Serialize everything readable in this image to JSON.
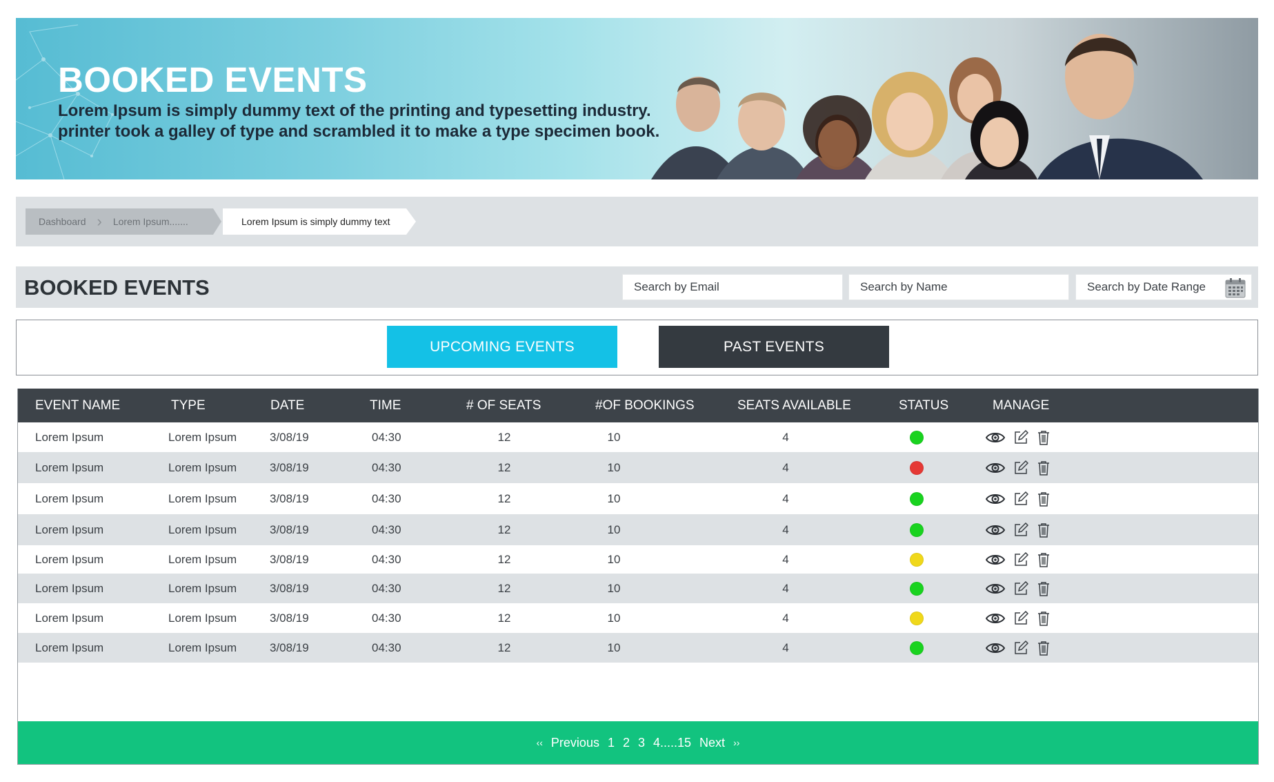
{
  "banner": {
    "title": "BOOKED EVENTS",
    "subtitle_line1": "Lorem Ipsum is simply dummy text of the printing and typesetting industry.",
    "subtitle_line2": "printer took a galley of type and scrambled it to make a type specimen book."
  },
  "breadcrumb": {
    "items": [
      "Dashboard",
      "Lorem Ipsum.......",
      "Lorem Ipsum is simply dummy text"
    ]
  },
  "section": {
    "title": "BOOKED EVENTS",
    "search_email": "Search by Email",
    "search_name": "Search by Name",
    "search_date": "Search by Date Range"
  },
  "tabs": {
    "upcoming": "UPCOMING EVENTS",
    "past": "PAST EVENTS",
    "active": "upcoming"
  },
  "colors": {
    "accent": "#14c1e6",
    "header_dark": "#3d4349",
    "pager_green": "#12c37f",
    "status_green": "#19d31f",
    "status_red": "#e53935",
    "status_yellow": "#f0d81a"
  },
  "table": {
    "columns": [
      "EVENT NAME",
      "TYPE",
      "DATE",
      "TIME",
      "# OF SEATS",
      "#OF BOOKINGS",
      "SEATS AVAILABLE",
      "STATUS",
      "MANAGE"
    ],
    "rows": [
      {
        "name": "Lorem Ipsum",
        "type": "Lorem Ipsum",
        "date": "3/08/19",
        "time": "04:30",
        "seats": "12",
        "bookings": "10",
        "available": "4",
        "status": "green"
      },
      {
        "name": "Lorem Ipsum",
        "type": "Lorem Ipsum",
        "date": "3/08/19",
        "time": "04:30",
        "seats": "12",
        "bookings": "10",
        "available": "4",
        "status": "red"
      },
      {
        "name": "Lorem Ipsum",
        "type": "Lorem Ipsum",
        "date": "3/08/19",
        "time": "04:30",
        "seats": "12",
        "bookings": "10",
        "available": "4",
        "status": "green"
      },
      {
        "name": "Lorem Ipsum",
        "type": "Lorem Ipsum",
        "date": "3/08/19",
        "time": "04:30",
        "seats": "12",
        "bookings": "10",
        "available": "4",
        "status": "green"
      },
      {
        "name": "Lorem Ipsum",
        "type": "Lorem Ipsum",
        "date": "3/08/19",
        "time": "04:30",
        "seats": "12",
        "bookings": "10",
        "available": "4",
        "status": "yellow"
      },
      {
        "name": "Lorem Ipsum",
        "type": "Lorem Ipsum",
        "date": "3/08/19",
        "time": "04:30",
        "seats": "12",
        "bookings": "10",
        "available": "4",
        "status": "green"
      },
      {
        "name": "Lorem Ipsum",
        "type": "Lorem Ipsum",
        "date": "3/08/19",
        "time": "04:30",
        "seats": "12",
        "bookings": "10",
        "available": "4",
        "status": "yellow"
      },
      {
        "name": "Lorem Ipsum",
        "type": "Lorem Ipsum",
        "date": "3/08/19",
        "time": "04:30",
        "seats": "12",
        "bookings": "10",
        "available": "4",
        "status": "green"
      }
    ],
    "manage_icons": [
      "eye-icon",
      "edit-icon",
      "trash-icon"
    ]
  },
  "pagination": {
    "prev_glyph": "‹‹",
    "previous": "Previous",
    "pages": [
      "1",
      "2",
      "3",
      "4.....15"
    ],
    "next": "Next",
    "next_glyph": "››"
  }
}
